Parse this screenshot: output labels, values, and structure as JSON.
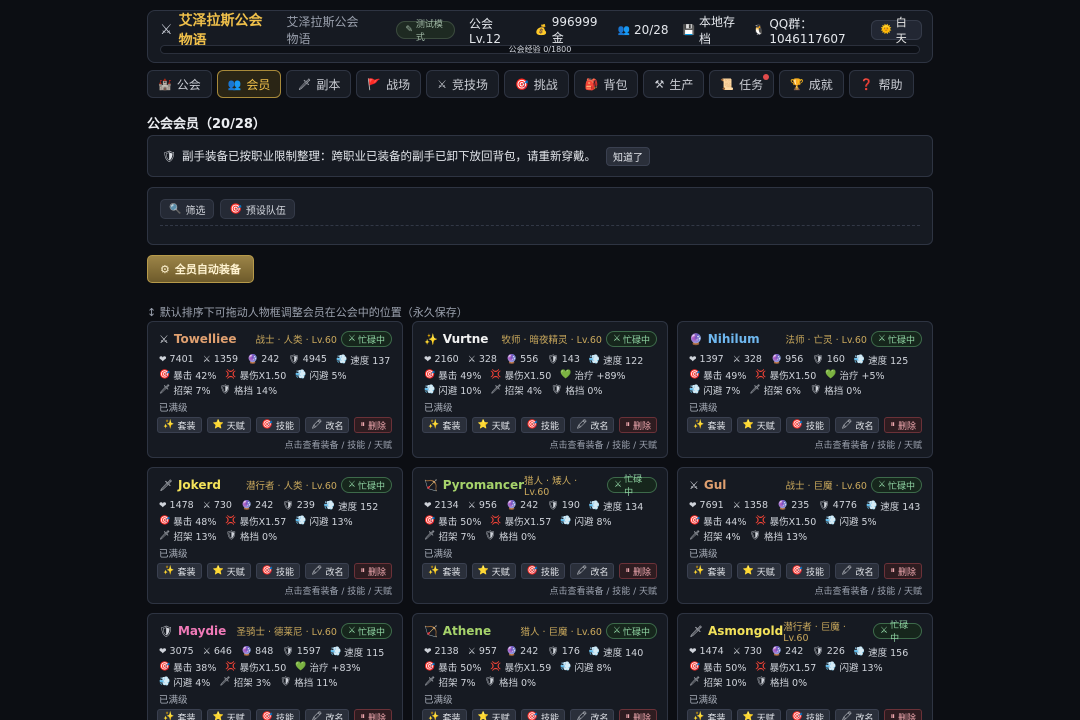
{
  "header": {
    "title": "艾泽拉斯公会物语",
    "subtitle": "艾泽拉斯公会物语",
    "test_badge": "测试模式",
    "guild_level": "公会 Lv.12",
    "gold": "996999 金",
    "members": "20/28",
    "save": "本地存档",
    "qq": "QQ群：1046117607",
    "daytime": "白天",
    "xp_text": "公会经验 0/1800",
    "xp_progress": 0
  },
  "tabs": [
    {
      "label": "公会",
      "icon": "castle-icon",
      "glyph": "🏰"
    },
    {
      "label": "会员",
      "icon": "members-icon",
      "glyph": "👥"
    },
    {
      "label": "副本",
      "icon": "dagger-icon",
      "glyph": "🗡"
    },
    {
      "label": "战场",
      "icon": "flag-icon",
      "glyph": "🚩"
    },
    {
      "label": "竞技场",
      "icon": "swords-icon",
      "glyph": "⚔"
    },
    {
      "label": "挑战",
      "icon": "target-icon",
      "glyph": "🎯"
    },
    {
      "label": "背包",
      "icon": "bag-icon",
      "glyph": "🎒"
    },
    {
      "label": "生产",
      "icon": "tools-icon",
      "glyph": "⚒"
    },
    {
      "label": "任务",
      "icon": "scroll-icon",
      "glyph": "📜"
    },
    {
      "label": "成就",
      "icon": "trophy-icon",
      "glyph": "🏆"
    },
    {
      "label": "帮助",
      "icon": "question-icon",
      "glyph": "❓"
    }
  ],
  "active_tab": 1,
  "section_title": "公会会员（20/28）",
  "notice": {
    "text": "副手装备已按职业限制整理：跨职业已装备的副手已卸下放回背包，请重新穿戴。",
    "button": "知道了"
  },
  "filter": {
    "filter_label": "筛选",
    "preset_label": "预设队伍"
  },
  "auto_equip": "全员自动装备",
  "hint": "↕ 默认排序下可拖动人物框调整会员在公会中的位置（永久保存）",
  "labels": {
    "maxed": "已满级",
    "footer": "点击查看装备 / 技能 / 天赋",
    "status": "忙碌中",
    "btn_set": "套装",
    "btn_talent": "天赋",
    "btn_skill": "技能",
    "btn_rename": "改名",
    "btn_delete": "删除"
  },
  "colors": {
    "accent_gold": "#f0c04a",
    "card_border": "#2e3442",
    "status_green": "#8fd3a2",
    "delete_red": "#f0a9b0"
  },
  "members": [
    {
      "name": "Towelliee",
      "color": "#e0a070",
      "icon": "⚔",
      "info": "战士 · 人类 · Lv.60",
      "lines": [
        [
          [
            "❤",
            "7401"
          ],
          [
            "⚔",
            "1359"
          ],
          [
            "🔮",
            "242"
          ],
          [
            "🛡",
            "4945"
          ],
          [
            "💨",
            "速度 137"
          ]
        ],
        [
          [
            "🎯",
            "暴击 42%"
          ],
          [
            "💢",
            "暴伤X1.50"
          ],
          [
            "💨",
            "闪避 5%"
          ]
        ],
        [
          [
            "🗡",
            "招架 7%"
          ],
          [
            "🛡",
            "格挡 14%"
          ]
        ]
      ]
    },
    {
      "name": "Vurtne",
      "color": "#f2f2f2",
      "icon": "✨",
      "info": "牧师 · 暗夜精灵 · Lv.60",
      "lines": [
        [
          [
            "❤",
            "2160"
          ],
          [
            "⚔",
            "328"
          ],
          [
            "🔮",
            "556"
          ],
          [
            "🛡",
            "143"
          ],
          [
            "💨",
            "速度 122"
          ]
        ],
        [
          [
            "🎯",
            "暴击 49%"
          ],
          [
            "💢",
            "暴伤X1.50"
          ],
          [
            "💚",
            "治疗 +89%"
          ]
        ],
        [
          [
            "💨",
            "闪避 10%"
          ],
          [
            "🗡",
            "招架 4%"
          ],
          [
            "🛡",
            "格挡 0%"
          ]
        ]
      ]
    },
    {
      "name": "Nihilum",
      "color": "#6fb8f0",
      "icon": "🔮",
      "info": "法师 · 亡灵 · Lv.60",
      "lines": [
        [
          [
            "❤",
            "1397"
          ],
          [
            "⚔",
            "328"
          ],
          [
            "🔮",
            "956"
          ],
          [
            "🛡",
            "160"
          ],
          [
            "💨",
            "速度 125"
          ]
        ],
        [
          [
            "🎯",
            "暴击 49%"
          ],
          [
            "💢",
            "暴伤X1.50"
          ],
          [
            "💚",
            "治疗 +5%"
          ]
        ],
        [
          [
            "💨",
            "闪避 7%"
          ],
          [
            "🗡",
            "招架 6%"
          ],
          [
            "🛡",
            "格挡 0%"
          ]
        ]
      ]
    },
    {
      "name": "Jokerd",
      "color": "#f3e25a",
      "icon": "🗡",
      "info": "潜行者 · 人类 · Lv.60",
      "lines": [
        [
          [
            "❤",
            "1478"
          ],
          [
            "⚔",
            "730"
          ],
          [
            "🔮",
            "242"
          ],
          [
            "🛡",
            "239"
          ],
          [
            "💨",
            "速度 152"
          ]
        ],
        [
          [
            "🎯",
            "暴击 48%"
          ],
          [
            "💢",
            "暴伤X1.57"
          ],
          [
            "💨",
            "闪避 13%"
          ]
        ],
        [
          [
            "🗡",
            "招架 13%"
          ],
          [
            "🛡",
            "格挡 0%"
          ]
        ]
      ]
    },
    {
      "name": "Pyromancer",
      "color": "#a6d36b",
      "icon": "🏹",
      "info": "猎人 · 矮人 · Lv.60",
      "lines": [
        [
          [
            "❤",
            "2134"
          ],
          [
            "⚔",
            "956"
          ],
          [
            "🔮",
            "242"
          ],
          [
            "🛡",
            "190"
          ],
          [
            "💨",
            "速度 134"
          ]
        ],
        [
          [
            "🎯",
            "暴击 50%"
          ],
          [
            "💢",
            "暴伤X1.57"
          ],
          [
            "💨",
            "闪避 8%"
          ]
        ],
        [
          [
            "🗡",
            "招架 7%"
          ],
          [
            "🛡",
            "格挡 0%"
          ]
        ]
      ]
    },
    {
      "name": "Gul",
      "color": "#e0a070",
      "icon": "⚔",
      "info": "战士 · 巨魔 · Lv.60",
      "lines": [
        [
          [
            "❤",
            "7691"
          ],
          [
            "⚔",
            "1358"
          ],
          [
            "🔮",
            "235"
          ],
          [
            "🛡",
            "4776"
          ],
          [
            "💨",
            "速度 143"
          ]
        ],
        [
          [
            "🎯",
            "暴击 44%"
          ],
          [
            "💢",
            "暴伤X1.50"
          ],
          [
            "💨",
            "闪避 5%"
          ]
        ],
        [
          [
            "🗡",
            "招架 4%"
          ],
          [
            "🛡",
            "格挡 13%"
          ]
        ]
      ]
    },
    {
      "name": "Maydie",
      "color": "#f07ab8",
      "icon": "🛡",
      "info": "圣骑士 · 德莱尼 · Lv.60",
      "lines": [
        [
          [
            "❤",
            "3075"
          ],
          [
            "⚔",
            "646"
          ],
          [
            "🔮",
            "848"
          ],
          [
            "🛡",
            "1597"
          ],
          [
            "💨",
            "速度 115"
          ]
        ],
        [
          [
            "🎯",
            "暴击 38%"
          ],
          [
            "💢",
            "暴伤X1.50"
          ],
          [
            "💚",
            "治疗 +83%"
          ]
        ],
        [
          [
            "💨",
            "闪避 4%"
          ],
          [
            "🗡",
            "招架 3%"
          ],
          [
            "🛡",
            "格挡 11%"
          ]
        ]
      ]
    },
    {
      "name": "Athene",
      "color": "#a6d36b",
      "icon": "🏹",
      "info": "猎人 · 巨魔 · Lv.60",
      "lines": [
        [
          [
            "❤",
            "2138"
          ],
          [
            "⚔",
            "957"
          ],
          [
            "🔮",
            "242"
          ],
          [
            "🛡",
            "176"
          ],
          [
            "💨",
            "速度 140"
          ]
        ],
        [
          [
            "🎯",
            "暴击 50%"
          ],
          [
            "💢",
            "暴伤X1.59"
          ],
          [
            "💨",
            "闪避 8%"
          ]
        ],
        [
          [
            "🗡",
            "招架 7%"
          ],
          [
            "🛡",
            "格挡 0%"
          ]
        ]
      ]
    },
    {
      "name": "Asmongold",
      "color": "#f3e25a",
      "icon": "🗡",
      "info": "潜行者 · 巨魔 · Lv.60",
      "lines": [
        [
          [
            "❤",
            "1474"
          ],
          [
            "⚔",
            "730"
          ],
          [
            "🔮",
            "242"
          ],
          [
            "🛡",
            "226"
          ],
          [
            "💨",
            "速度 156"
          ]
        ],
        [
          [
            "🎯",
            "暴击 50%"
          ],
          [
            "💢",
            "暴伤X1.57"
          ],
          [
            "💨",
            "闪避 13%"
          ]
        ],
        [
          [
            "🗡",
            "招架 10%"
          ],
          [
            "🛡",
            "格挡 0%"
          ]
        ]
      ]
    }
  ]
}
